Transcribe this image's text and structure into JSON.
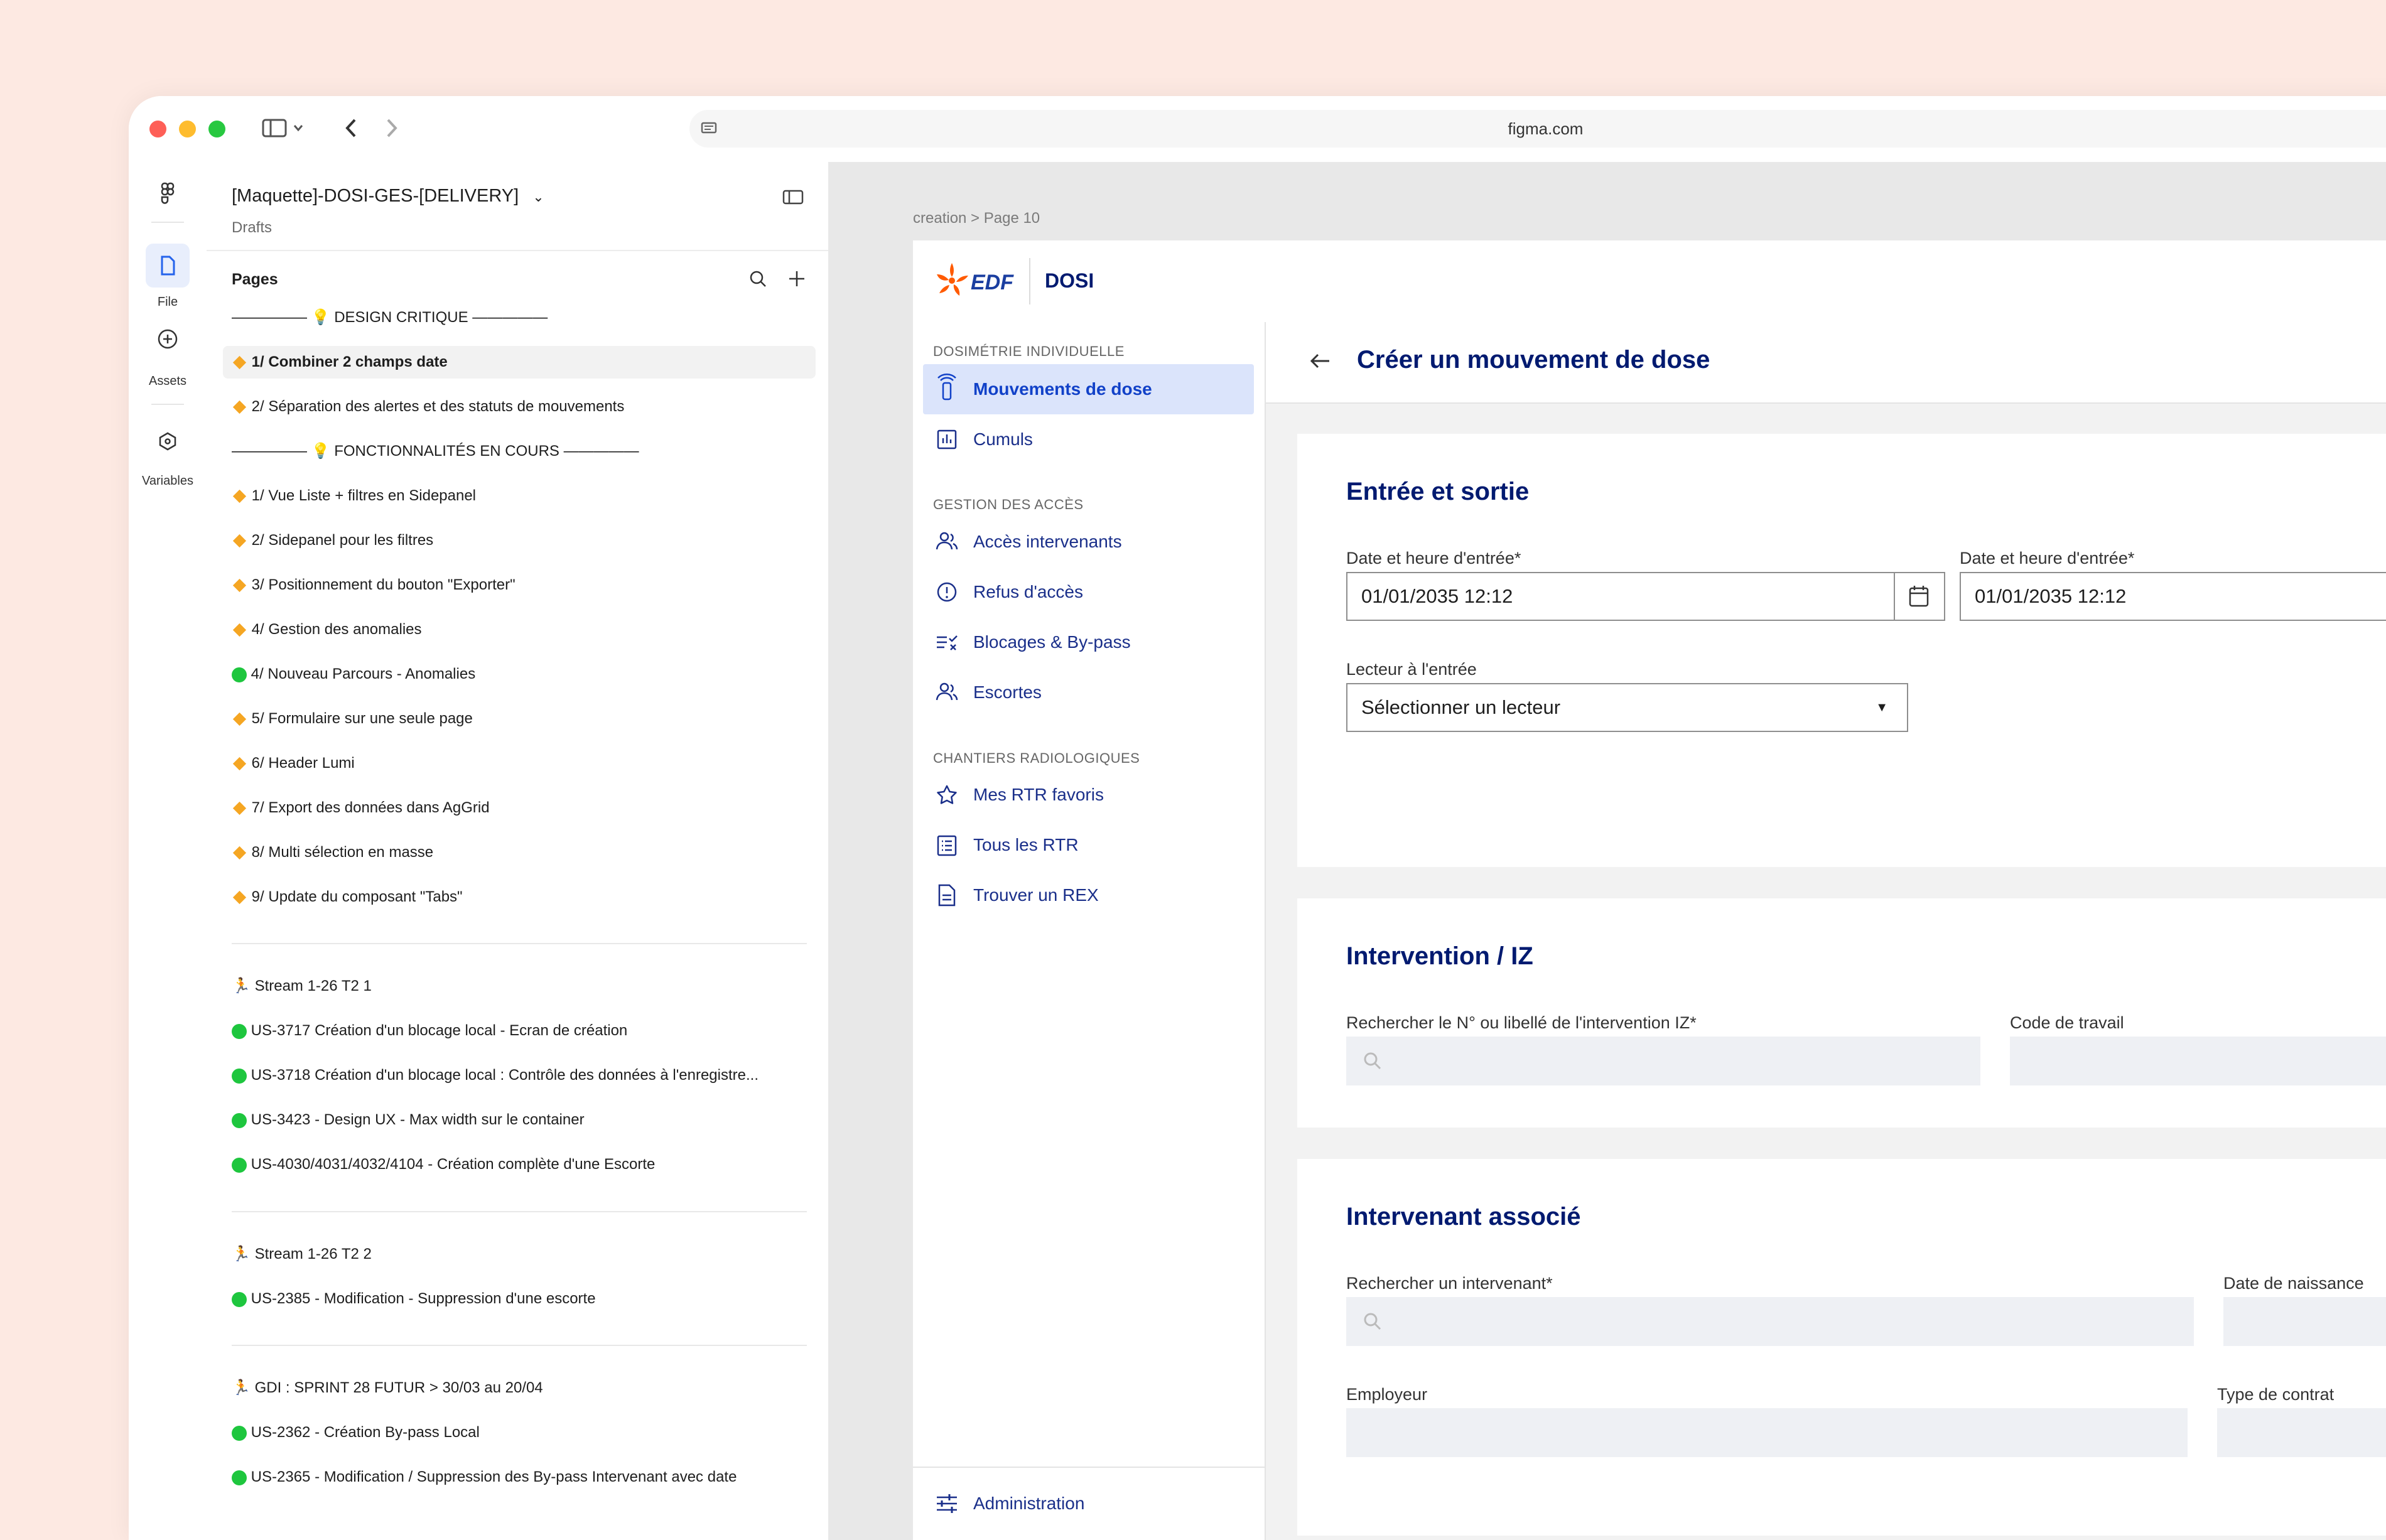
{
  "browser": {
    "url": "figma.com"
  },
  "rail": {
    "file": "File",
    "assets": "Assets",
    "variables": "Variables"
  },
  "figma": {
    "file_title": "[Maquette]-DOSI-GES-[DELIVERY]",
    "location": "Drafts",
    "pages_heading": "Pages",
    "pages": [
      {
        "marker": "",
        "label": "————— 💡 DESIGN CRITIQUE —————"
      },
      {
        "marker": "diamond",
        "label": "1/ Combiner 2 champs date"
      },
      {
        "marker": "diamond",
        "label": "2/ Séparation des alertes et des statuts de mouvements"
      },
      {
        "marker": "",
        "label": "————— 💡 FONCTIONNALITÉS EN COURS —————"
      },
      {
        "marker": "diamond",
        "label": "1/ Vue Liste + filtres en Sidepanel"
      },
      {
        "marker": "diamond",
        "label": "2/ Sidepanel pour les filtres"
      },
      {
        "marker": "diamond",
        "label": "3/ Positionnement du bouton \"Exporter\""
      },
      {
        "marker": "diamond",
        "label": "4/ Gestion des anomalies"
      },
      {
        "marker": "green",
        "label": "4/ Nouveau Parcours - Anomalies"
      },
      {
        "marker": "diamond",
        "label": "5/ Formulaire sur une seule page"
      },
      {
        "marker": "diamond",
        "label": "6/ Header Lumi"
      },
      {
        "marker": "diamond",
        "label": "7/ Export des données dans AgGrid"
      },
      {
        "marker": "diamond",
        "label": "8/ Multi sélection en masse"
      },
      {
        "marker": "diamond",
        "label": "9/ Update du composant \"Tabs\""
      },
      {
        "marker": "run",
        "label": "Stream 1-26 T2 1"
      },
      {
        "marker": "green",
        "label": "US-3717 Création d'un blocage local - Ecran de création"
      },
      {
        "marker": "green",
        "label": "US-3718 Création d'un blocage local : Contrôle des données à l'enregistre..."
      },
      {
        "marker": "green",
        "label": "US-3423 - Design UX - Max width sur le container"
      },
      {
        "marker": "green",
        "label": "US-4030/4031/4032/4104 - Création complète d'une Escorte"
      },
      {
        "marker": "run",
        "label": "Stream 1-26 T2 2"
      },
      {
        "marker": "green",
        "label": "US-2385 - Modification - Suppression d'une escorte"
      },
      {
        "marker": "run",
        "label": "GDI : SPRINT 28 FUTUR > 30/03 au 20/04"
      },
      {
        "marker": "green",
        "label": "US-2362 - Création By-pass Local"
      },
      {
        "marker": "green",
        "label": "US-2365 - Modification / Suppression des By-pass Intervenant avec date"
      }
    ]
  },
  "canvas": {
    "breadcrumb": "creation > Page 10"
  },
  "app": {
    "brand": "EDF",
    "product": "DOSI",
    "nav": {
      "sec1": "DOSIMÉTRIE INDIVIDUELLE",
      "sec2": "GESTION DES ACCÈS",
      "sec3": "CHANTIERS RADIOLOGIQUES",
      "items": [
        {
          "label": "Mouvements de dose",
          "icon": "dosimeter-icon"
        },
        {
          "label": "Cumuls",
          "icon": "chart-icon"
        },
        {
          "label": "Accès intervenants",
          "icon": "users-icon"
        },
        {
          "label": "Refus d'accès",
          "icon": "alert-circle-icon"
        },
        {
          "label": "Blocages & By-pass",
          "icon": "list-check-icon"
        },
        {
          "label": "Escortes",
          "icon": "users-icon"
        },
        {
          "label": "Mes RTR favoris",
          "icon": "star-icon"
        },
        {
          "label": "Tous les RTR",
          "icon": "list-icon"
        },
        {
          "label": "Trouver un REX",
          "icon": "document-icon"
        }
      ],
      "admin": "Administration"
    },
    "page_title": "Créer un mouvement de dose",
    "sections": {
      "s1": {
        "title": "Entrée et sortie",
        "date_in_label": "Date et heure d'entrée*",
        "date_in_value": "01/01/2035  12:12",
        "date_out_label": "Date et heure d'entrée*",
        "date_out_value": "01/01/2035  12:12",
        "reader_label": "Lecteur à l'entrée",
        "reader_value": "Sélectionner un lecteur"
      },
      "s2": {
        "title": "Intervention / IZ",
        "search_label": "Rechercher le N° ou libellé de l'intervention IZ*",
        "code_label": "Code de travail"
      },
      "s3": {
        "title": "Intervenant associé",
        "search_label": "Rechercher un intervenant*",
        "birth_label": "Date de naissance",
        "employer_label": "Employeur",
        "contract_label": "Type de contrat"
      }
    }
  }
}
